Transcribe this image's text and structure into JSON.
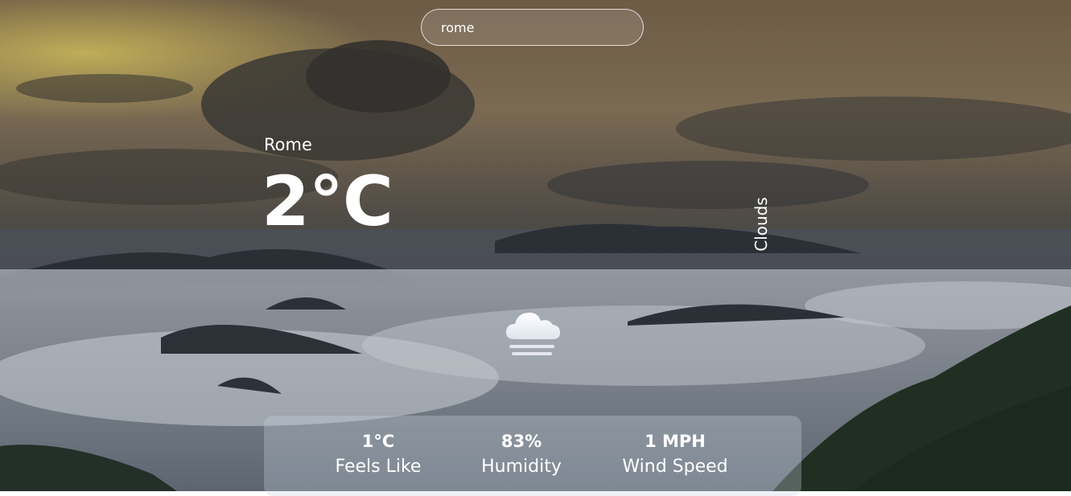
{
  "search": {
    "value": "rome",
    "placeholder": ""
  },
  "weather": {
    "city": "Rome",
    "temperature": "2°C",
    "description": "Clouds",
    "icon": "cloud-fog-icon"
  },
  "stats": {
    "feels_like": {
      "value": "1°C",
      "label": "Feels Like"
    },
    "humidity": {
      "value": "83%",
      "label": "Humidity"
    },
    "wind": {
      "value": "1 MPH",
      "label": "Wind Speed"
    }
  }
}
